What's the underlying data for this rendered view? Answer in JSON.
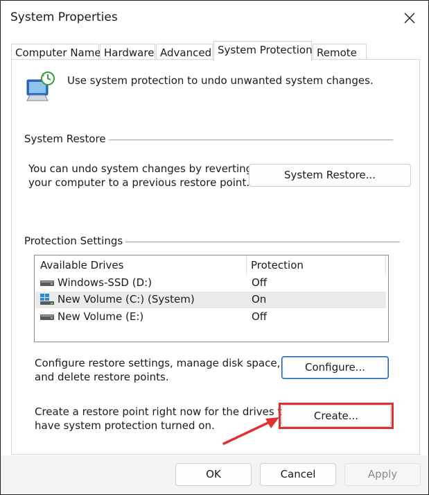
{
  "window": {
    "title": "System Properties"
  },
  "tabs": [
    {
      "label": "Computer Name"
    },
    {
      "label": "Hardware"
    },
    {
      "label": "Advanced"
    },
    {
      "label": "System Protection"
    },
    {
      "label": "Remote"
    }
  ],
  "active_tab": "System Protection",
  "header": {
    "text": "Use system protection to undo unwanted system changes."
  },
  "system_restore": {
    "group_label": "System Restore",
    "description_line1": "You can undo system changes by reverting",
    "description_line2": "your computer to a previous restore point.",
    "button_label": "System Restore..."
  },
  "protection_settings": {
    "group_label": "Protection Settings",
    "columns": [
      "Available Drives",
      "Protection"
    ],
    "drives": [
      {
        "name": "Windows-SSD (D:)",
        "protection": "Off",
        "icon": "drive-icon",
        "selected": false
      },
      {
        "name": "New Volume (C:) (System)",
        "protection": "On",
        "icon": "system-drive-icon",
        "selected": true
      },
      {
        "name": "New Volume (E:)",
        "protection": "Off",
        "icon": "drive-icon",
        "selected": false
      }
    ],
    "configure_line1": "Configure restore settings, manage disk space,",
    "configure_line2": "and delete restore points.",
    "configure_button": "Configure...",
    "create_line1": "Create a restore point right now for the drives that",
    "create_line2": "have system protection turned on.",
    "create_button": "Create..."
  },
  "footer": {
    "ok": "OK",
    "cancel": "Cancel",
    "apply": "Apply"
  },
  "colors": {
    "highlight": "#e03131",
    "focus": "#1a5fb4",
    "selected_row": "#ebebeb"
  }
}
